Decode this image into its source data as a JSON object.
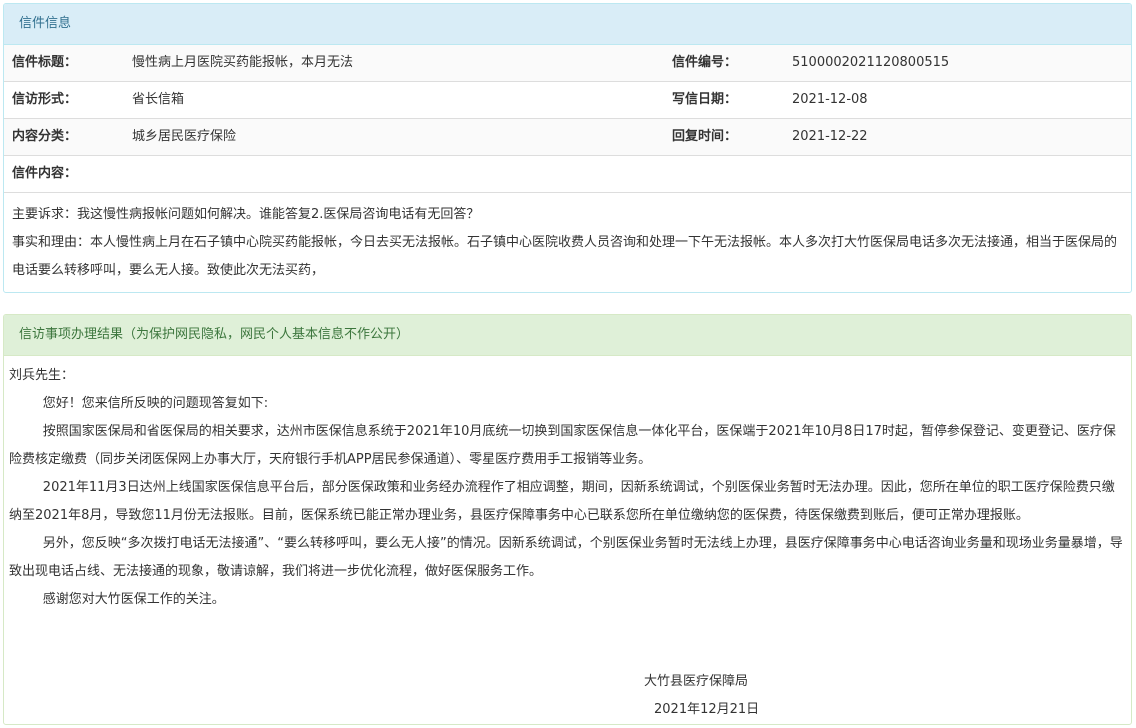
{
  "letter_panel": {
    "header": "信件信息",
    "title_label": "信件标题：",
    "title_value": "慢性病上月医院买药能报帐，本月无法",
    "number_label": "信件编号：",
    "number_value": "510000202112080051​5",
    "form_label": "信访形式：",
    "form_value": "省长信箱",
    "date_label": "写信日期：",
    "date_value": "2021-12-08",
    "category_label": "内容分类：",
    "category_value": "城乡居民医疗保险",
    "reply_time_label": "回复时间：",
    "reply_time_value": "2021-12-22",
    "content_label": "信件内容：",
    "content_line1": "主要诉求：我这慢性病报帐问题如何解决。谁能答复2.医保局咨询电话有无回答？",
    "content_line2": "事实和理由：本人慢性病上月在石子镇中心院买药能报帐，今日去买无法报帐。石子镇中心医院收费人员咨询和处理一下午无法报帐。本人多次打大竹医保局电话多次无法接通，相当于医保局的电话要么转移呼叫，要么无人接。致使此次无法买药，"
  },
  "result_panel": {
    "header": "信访事项办理结果（为保护网民隐私，网民个人基本信息不作公开）",
    "salutation": "刘兵先生：",
    "greeting": "您好！您来信所反映的问题现答复如下:",
    "para1": "按照国家医保局和省医保局的相关要求，达州市医保信息系统于2021年10月底统一切换到国家医保信息一体化平台，医保端于2021年10月8日17时起，暂停参保登记、变更登记、医疗保险费核定缴费（同步关闭医保网上办事大厅，天府银行手机APP居民参保通道）、零星医疗费用手工报销等业务。",
    "para2": "2021年11月3日达州上线国家医保信息平台后，部分医保政策和业务经办流程作了相应调整，期间，因新系统调试，个别医保业务暂时无法办理。因此，您所在单位的职工医疗保险费只缴纳至2021年8月，导致您11月份无法报账。目前，医保系统已能正常办理业务，县医疗保障事务中心已联系您所在单位缴纳您的医保费，待医保缴费到账后，便可正常办理报账。",
    "para3": "另外，您反映“多次拨打电话无法接通”、“要么转移呼叫，要么无人接”的情况。因新系统调试，个别医保业务暂时无法线上办理，县医疗保障事务中心电话咨询业务量和现场业务量暴增，导致出现电话占线、无法接通的现象，敬请谅解，我们将进一步优化流程，做好医保服务工作。",
    "thanks": "感谢您对大竹医保工作的关注。",
    "signature": "大竹县医疗保障局",
    "sign_date": "2021年12月21日"
  },
  "colors": {
    "info_header_bg": "#d9edf7",
    "info_header_text": "#31708f",
    "result_header_bg": "#dff0d8",
    "result_header_text": "#3c763d"
  }
}
